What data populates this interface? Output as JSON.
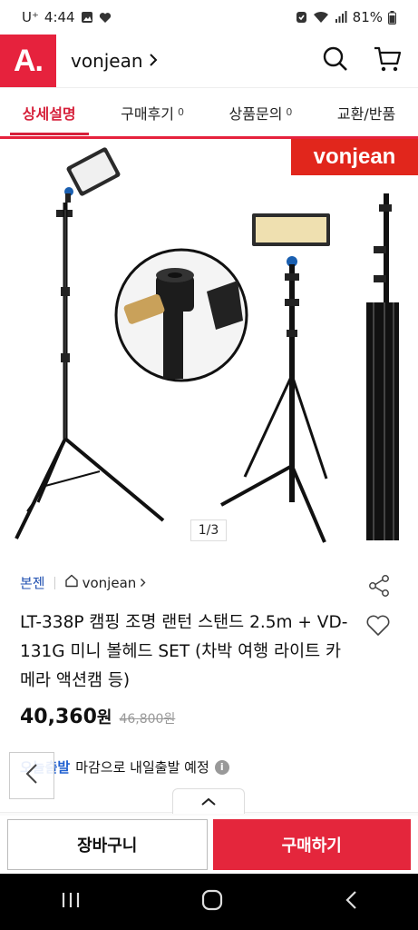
{
  "status_bar": {
    "carrier": "U⁺",
    "time": "4:44",
    "battery": "81%"
  },
  "header": {
    "logo": "A.",
    "store_name": "vonjean"
  },
  "tabs": [
    {
      "label": "상세설명",
      "count": ""
    },
    {
      "label": "구매후기",
      "count": "0"
    },
    {
      "label": "상품문의",
      "count": "0"
    },
    {
      "label": "교환/반품",
      "count": ""
    }
  ],
  "gallery": {
    "brand_banner": "vonjean",
    "counter": "1/3"
  },
  "product": {
    "tag": "본젠",
    "shop_name": "vonjean",
    "title": "LT-338P 캠핑 조명 랜턴 스탠드 2.5m + VD-131G 미니 볼헤드 SET (차박 여행 라이트 카메라 액션캠 등)",
    "price": "40,360",
    "price_unit": "원",
    "original_price": "46,800원"
  },
  "delivery": {
    "badge": "오늘출발",
    "text": "마감으로 내일출발 예정",
    "info": "i"
  },
  "actions": {
    "cart": "장바구니",
    "buy": "구매하기"
  },
  "colors": {
    "brand_red": "#e6223d",
    "link_blue": "#1f4fb0",
    "nav_black": "#000000"
  }
}
